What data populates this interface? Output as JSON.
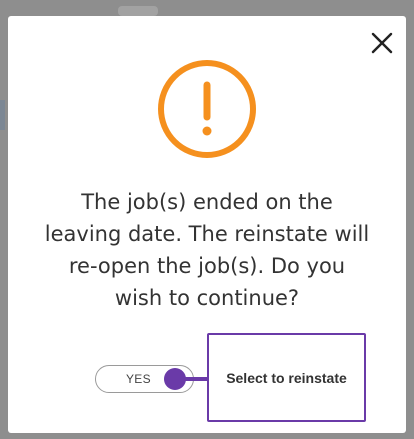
{
  "dialog": {
    "close_icon": "close-icon",
    "alert_icon": "exclamation-circle-icon",
    "accent_color": "#f5901e",
    "message": "The job(s) ended on the\nleaving date. The reinstate will\nre-open the job(s). Do you\nwish to continue?"
  },
  "toggle": {
    "label": "YES",
    "state": "on",
    "knob_color": "#6a3aa8"
  },
  "tooltip": {
    "text": "Select to reinstate",
    "border_color": "#6a3aa8"
  }
}
